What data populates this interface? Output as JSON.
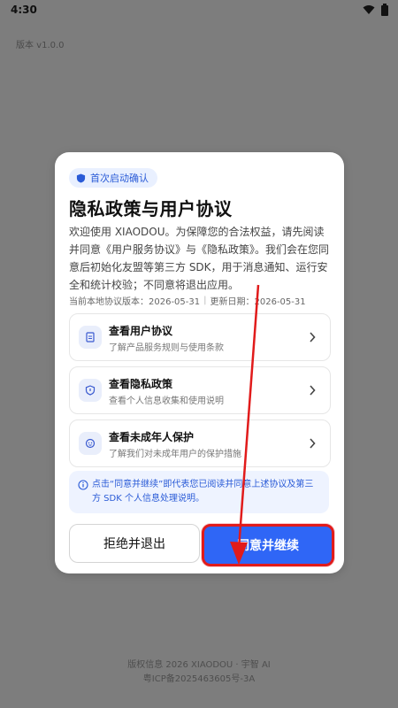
{
  "status": {
    "time": "4:30"
  },
  "app": {
    "version": "版本 v1.0.0"
  },
  "dialog": {
    "badge": "首次启动确认",
    "title": "隐私政策与用户协议",
    "intro": "欢迎使用 XIAODOU。为保障您的合法权益，请先阅读并同意《用户服务协议》与《隐私政策》。我们会在您同意后初始化友盟等第三方 SDK，用于消息通知、运行安全和统计校验；不同意将退出应用。",
    "meta": {
      "version_label": "当前本地协议版本：2026-05-31",
      "updated_label": "更新日期：2026-05-31"
    },
    "items": [
      {
        "title": "查看用户协议",
        "subtitle": "了解产品服务规则与使用条款",
        "icon": "document-icon"
      },
      {
        "title": "查看隐私政策",
        "subtitle": "查看个人信息收集和使用说明",
        "icon": "shield-icon"
      },
      {
        "title": "查看未成年人保护",
        "subtitle": "了解我们对未成年用户的保护措施",
        "icon": "child-face-icon"
      }
    ],
    "notice": "点击“同意并继续”即代表您已阅读并同意上述协议及第三方 SDK 个人信息处理说明。",
    "buttons": {
      "reject": "拒绝并退出",
      "accept": "同意并继续"
    }
  },
  "footer": {
    "line1": "版权信息 2026 XIAODOU · 宇智 AI",
    "line2": "粤ICP备2025463605号-3A"
  },
  "colors": {
    "accent": "#2f66f6",
    "highlight": "#e11b1b",
    "overlay": "#7d7d7d"
  }
}
